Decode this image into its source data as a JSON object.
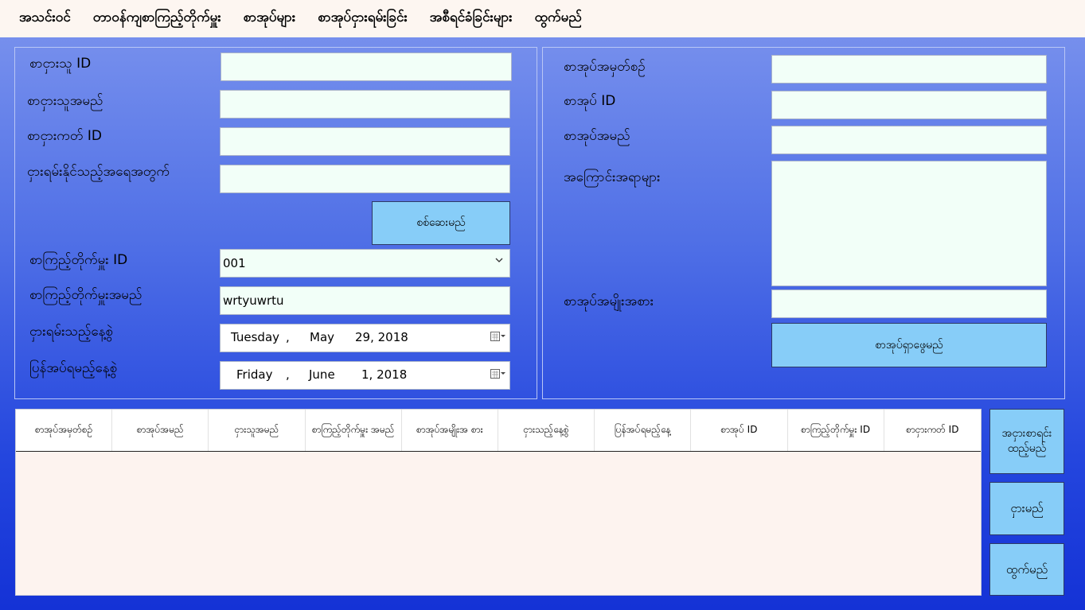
{
  "menu": [
    "အသင်းဝင်",
    "တာဝန်ကျစာကြည့်တိုက်မှူး",
    "စာအုပ်များ",
    "စာအုပ်ငှားရမ်းခြင်း",
    "အစီရင်ခံခြင်းများ",
    "ထွက်မည်"
  ],
  "borrower": {
    "id_label": "စာငှားသူ ID",
    "name_label": "စာငှားသူအမည်",
    "card_label": "စာငှားကတ် ID",
    "borrow_limit_label": "ငှားရမ်းနိုင်သည့်အရေအတွက်",
    "check_button": "စစ်ဆေးမည်",
    "id_value": "",
    "name_value": "",
    "card_value": "",
    "borrow_limit_value": ""
  },
  "librarian": {
    "id_label": "စာကြည့်တိုက်မှူး ID",
    "id_value": "001",
    "name_label": "စာကြည့်တိုက်မှူးအမည်",
    "name_value": "wrtyuwrtu"
  },
  "dates": {
    "borrow_label": "ငှားရမ်းသည့်နေ့စွဲ",
    "borrow_day": "Tuesday",
    "borrow_month": "May",
    "borrow_daynum": "29, 2018",
    "return_label": "ပြန်အပ်ရမည့်နေ့စွဲ",
    "return_day": "Friday",
    "return_month": "June",
    "return_daynum": "1, 2018",
    "comma": ","
  },
  "book": {
    "reg_label": "စာအုပ်အမှတ်စဉ်",
    "id_label": "စာအုပ် ID",
    "name_label": "စာအုပ်အမည်",
    "desc_label": "အကြောင်းအရာများ",
    "type_label": "စာအုပ်အမျိုးအစား",
    "search_button": "စာအုပ်ရှာဖွေမည်",
    "reg_value": "",
    "id_value": "",
    "name_value": "",
    "desc_value": "",
    "type_value": ""
  },
  "table": {
    "columns": [
      "စာအုပ်အမှတ်စဉ်",
      "စာအုပ်အမည်",
      "ငှားသူအမည်",
      "စာကြည့်တိုက်မှူး အမည်",
      "စာအုပ်အမျိုးအ စား",
      "ငှားသည့်နေ့စွဲ",
      "ပြန်အပ်ရမည့်နေ့",
      "စာအုပ် ID",
      "စာကြည့်တိုက်မှူး ID",
      "စာငှားကတ် ID"
    ]
  },
  "actions": {
    "add_list": "အငှားစာရင်း ထည့်မည်",
    "borrow": "ငှားမည်",
    "exit": "ထွက်မည်"
  },
  "icons": {
    "dropdown": "chevron-down-icon",
    "calendar": "calendar-icon"
  }
}
